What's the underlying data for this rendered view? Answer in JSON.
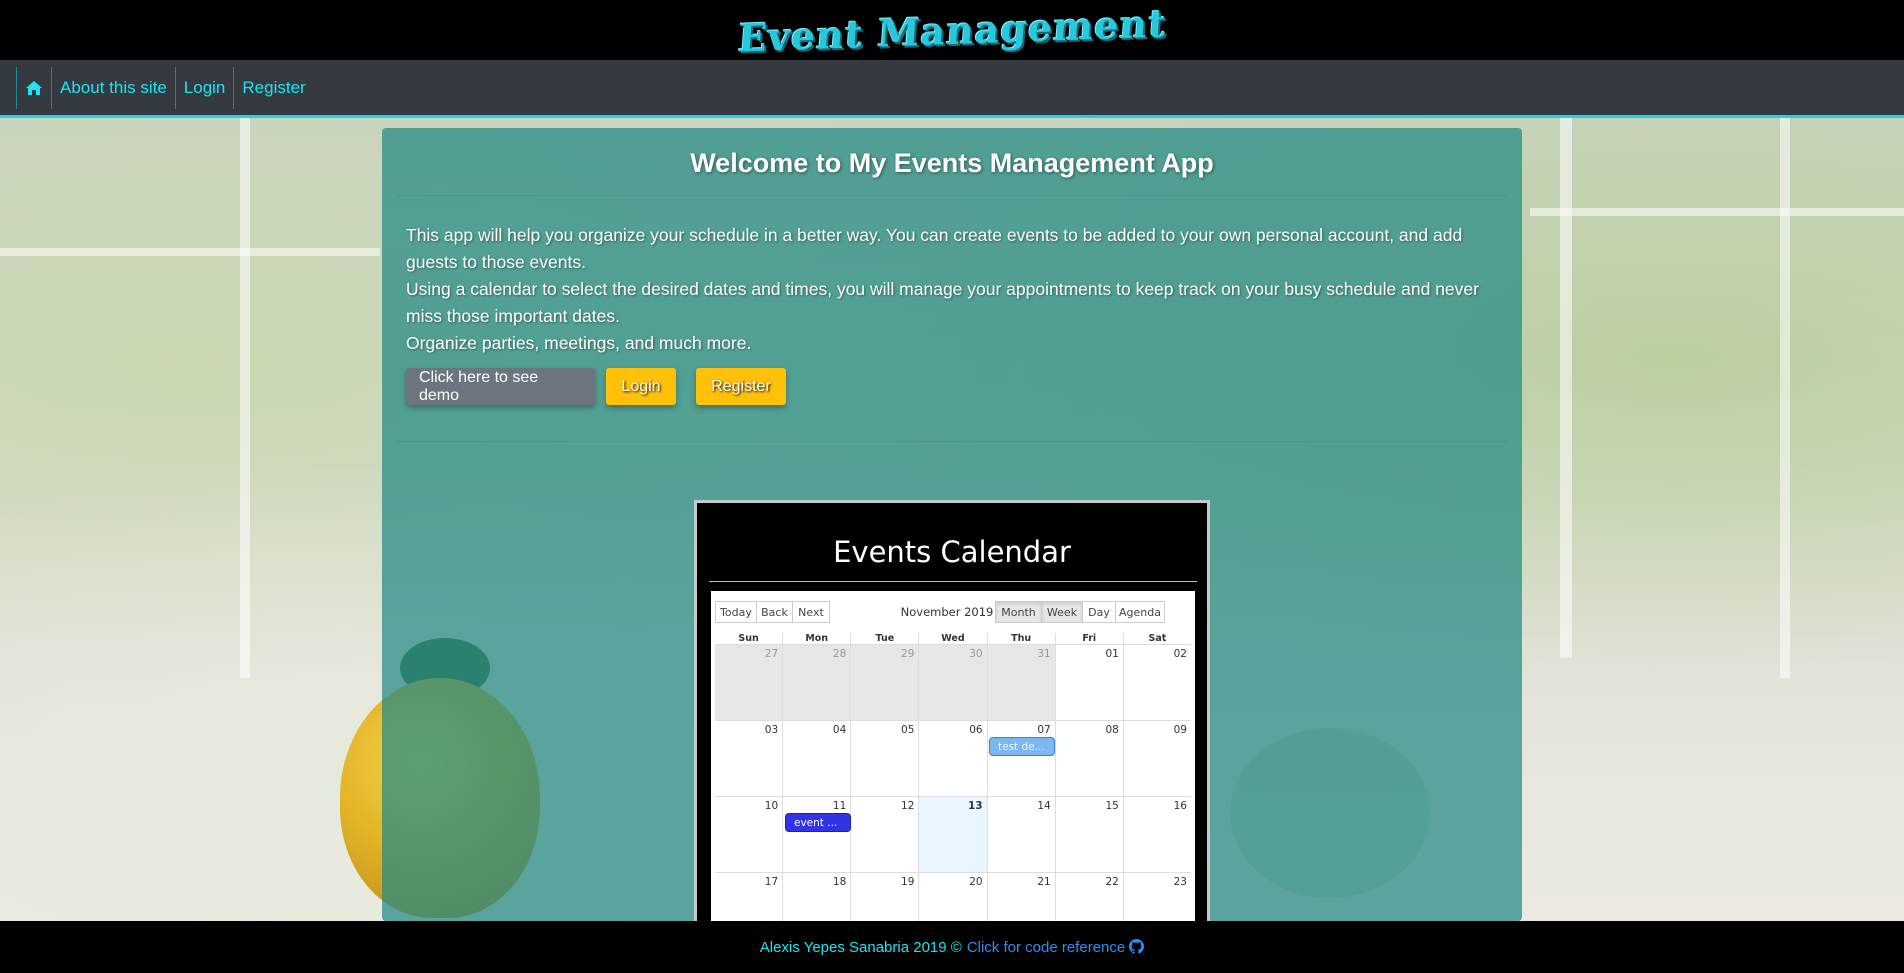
{
  "header": {
    "brand": "Event Management"
  },
  "nav": {
    "home_icon": "home-icon",
    "items": [
      "About this site",
      "Login",
      "Register"
    ]
  },
  "card": {
    "title": "Welcome to My Events Management App",
    "paragraphs": [
      "This app will help you organize your schedule in a better way. You can create events to be added to your own personal account, and add guests to those events.",
      "Using a calendar to select the desired dates and times, you will manage your appointments to keep track on your busy schedule and never miss those important dates.",
      "Organize parties, meetings, and much more."
    ],
    "buttons": {
      "demo": "Click here to see demo",
      "login": "Login",
      "register": "Register"
    }
  },
  "calendar": {
    "heading": "Events Calendar",
    "nav_buttons": [
      "Today",
      "Back",
      "Next"
    ],
    "month_label": "November 2019",
    "view_buttons": [
      "Month",
      "Week",
      "Day",
      "Agenda"
    ],
    "active_view": "Month",
    "weekdays": [
      "Sun",
      "Mon",
      "Tue",
      "Wed",
      "Thu",
      "Fri",
      "Sat"
    ],
    "weeks": [
      [
        "27",
        "28",
        "29",
        "30",
        "31",
        "01",
        "02"
      ],
      [
        "03",
        "04",
        "05",
        "06",
        "07",
        "08",
        "09"
      ],
      [
        "10",
        "11",
        "12",
        "13",
        "14",
        "15",
        "16"
      ],
      [
        "17",
        "18",
        "19",
        "20",
        "21",
        "22",
        "23"
      ]
    ],
    "today": "13",
    "events": [
      {
        "label": "test de...",
        "day": "07",
        "style": "light"
      },
      {
        "label": "event ...",
        "day": "11",
        "style": "dark"
      }
    ]
  },
  "footer": {
    "author": "Alexis Yepes Sanabria 2019 ©",
    "link_text": "Click for code reference",
    "link_icon": "github-icon"
  },
  "colors": {
    "accent_cyan": "#1ee3f0",
    "card_teal": "#238984",
    "button_yellow": "#ffc107",
    "button_gray": "#6c757d",
    "link_blue": "#2f8cf5"
  }
}
